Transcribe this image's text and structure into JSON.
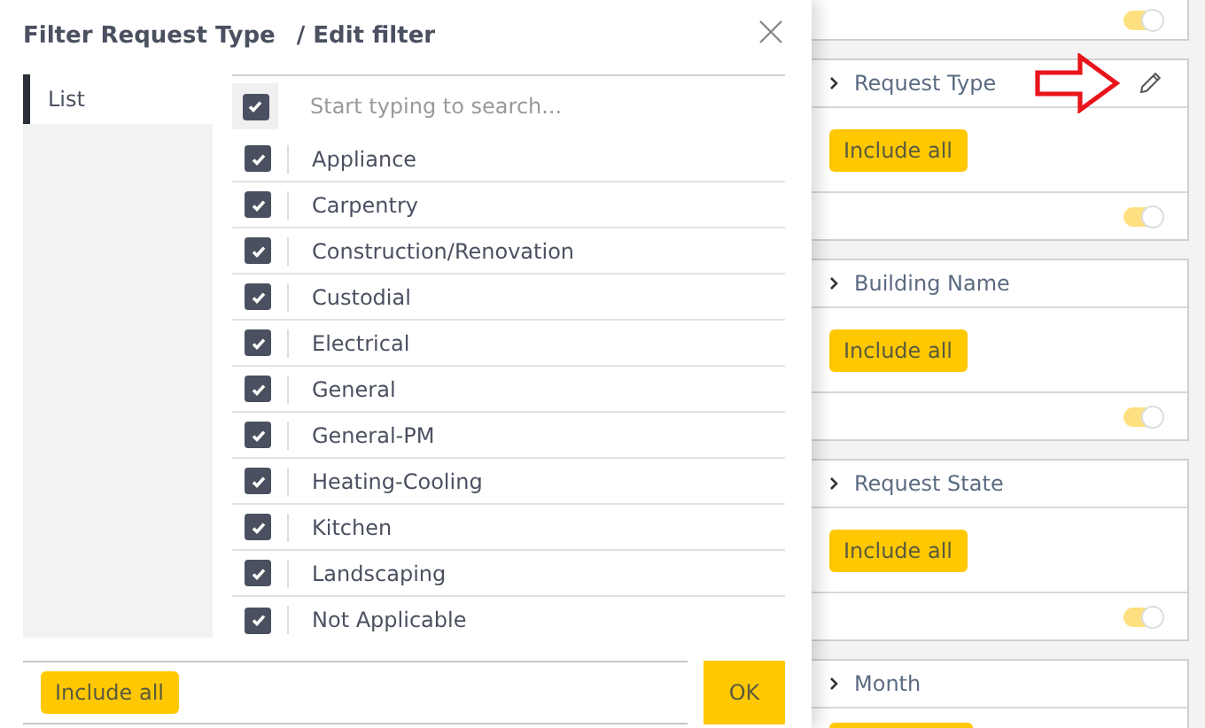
{
  "dialog": {
    "title": "Filter Request Type",
    "subtitle": "/ Edit filter",
    "tabs": [
      {
        "label": "List",
        "selected": true
      }
    ],
    "search": {
      "placeholder": "Start typing to search...",
      "checked": true
    },
    "items": [
      {
        "label": "Appliance",
        "checked": true
      },
      {
        "label": "Carpentry",
        "checked": true
      },
      {
        "label": "Construction/Renovation",
        "checked": true
      },
      {
        "label": "Custodial",
        "checked": true
      },
      {
        "label": "Electrical",
        "checked": true
      },
      {
        "label": "General",
        "checked": true
      },
      {
        "label": "General-PM",
        "checked": true
      },
      {
        "label": "Heating-Cooling",
        "checked": true
      },
      {
        "label": "Kitchen",
        "checked": true
      },
      {
        "label": "Landscaping",
        "checked": true
      },
      {
        "label": "Not Applicable",
        "checked": true
      }
    ],
    "footer_button": "Include all",
    "ok_button": "OK"
  },
  "filter_cards": [
    {
      "toggle_on": true
    },
    {
      "title": "Request Type",
      "button": "Include all",
      "toggle_on": true,
      "edit": true
    },
    {
      "title": "Building Name",
      "button": "Include all",
      "toggle_on": true,
      "edit": false
    },
    {
      "title": "Request State",
      "button": "Include all",
      "toggle_on": true,
      "edit": false
    },
    {
      "title": "Month",
      "edit": false,
      "cut": true
    }
  ]
}
